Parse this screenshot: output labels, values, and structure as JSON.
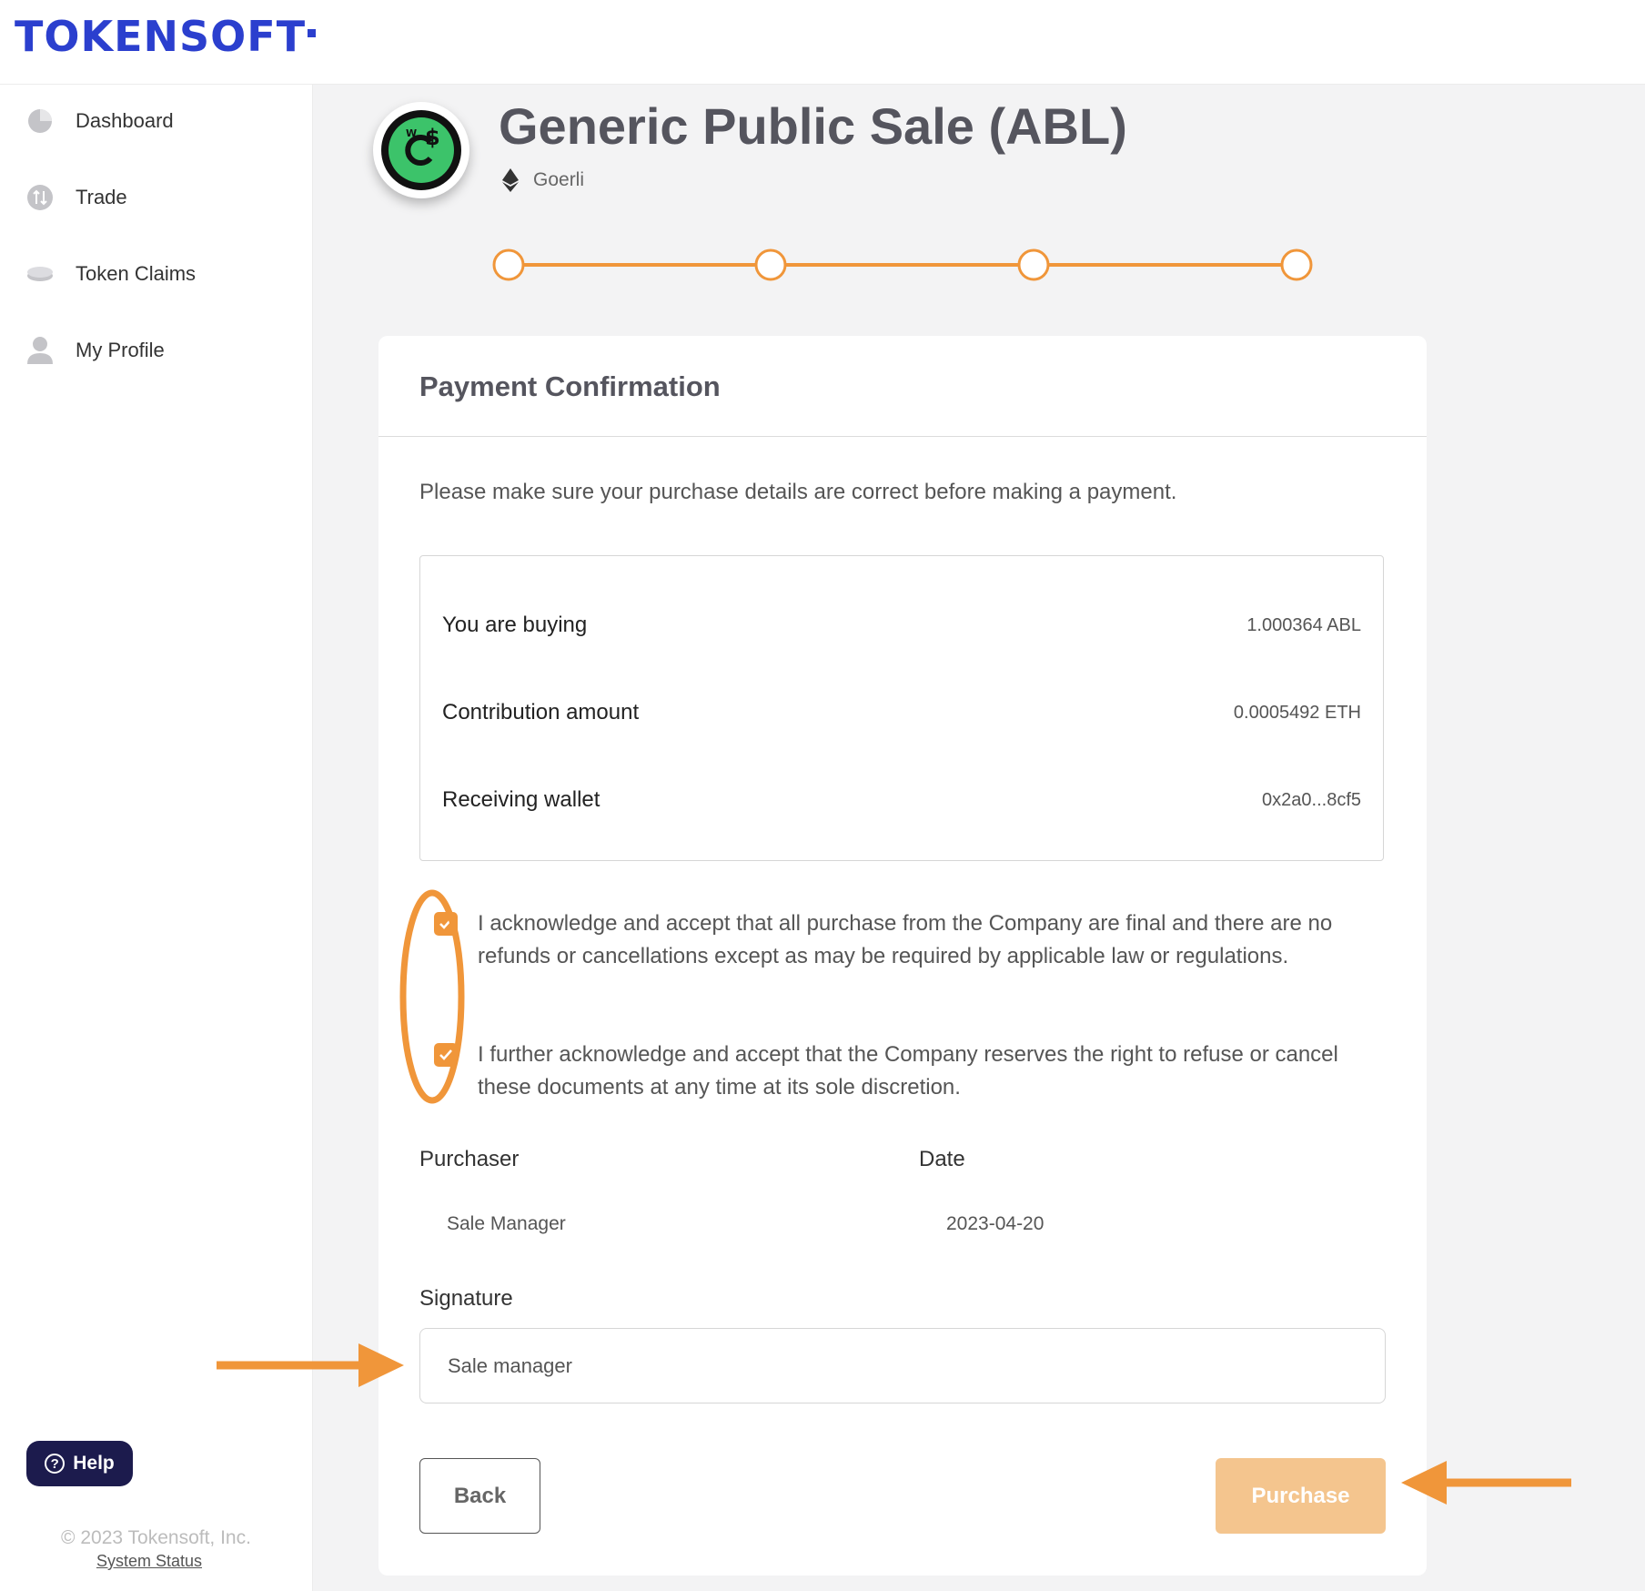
{
  "brand": {
    "name": "TOKENSOFT",
    "color": "#2b3fce"
  },
  "sidebar": {
    "items": [
      {
        "label": "Dashboard",
        "icon": "pie-chart-icon"
      },
      {
        "label": "Trade",
        "icon": "trade-icon"
      },
      {
        "label": "Token Claims",
        "icon": "coin-stack-icon"
      },
      {
        "label": "My Profile",
        "icon": "user-icon"
      }
    ],
    "help_label": "Help",
    "copyright": "© 2023 Tokensoft, Inc.",
    "system_status": "System Status"
  },
  "sale": {
    "title": "Generic Public Sale (ABL)",
    "network": "Goerli",
    "network_icon": "ethereum-icon",
    "steps": 4,
    "accent_color": "#f0963a"
  },
  "confirmation": {
    "title": "Payment Confirmation",
    "instruction": "Please make sure your purchase details are correct before making a payment.",
    "summary": [
      {
        "label": "You are buying",
        "value": "1.000364 ABL"
      },
      {
        "label": "Contribution amount",
        "value": "0.0005492 ETH"
      },
      {
        "label": "Receiving wallet",
        "value": "0x2a0...8cf5"
      }
    ],
    "acknowledgements": [
      {
        "text": "I acknowledge and accept that all purchase from the Company are final and there are no refunds or cancellations except as may be required by applicable law or regulations.",
        "checked": true
      },
      {
        "text": "I further acknowledge and accept that the Company reserves the right to refuse or cancel these documents at any time at its sole discretion.",
        "checked": true
      }
    ],
    "purchaser_label": "Purchaser",
    "purchaser_value": "Sale Manager",
    "date_label": "Date",
    "date_value": "2023-04-20",
    "signature_label": "Signature",
    "signature_value": "Sale manager",
    "back_label": "Back",
    "purchase_label": "Purchase",
    "purchase_color": "#f4c58e"
  }
}
